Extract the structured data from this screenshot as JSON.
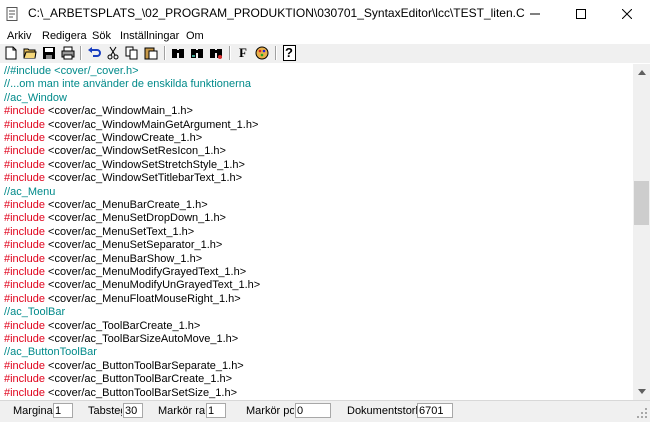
{
  "window": {
    "title": "C:\\_ARBETSPLATS_\\02_PROGRAM_PRODUKTION\\030701_SyntaxEditor\\lcc\\TEST_liten.C"
  },
  "menu": [
    "Arkiv",
    "Redigera",
    "Sök",
    "Inställningar",
    "Om"
  ],
  "toolbar": {
    "icons": [
      "new-file-icon",
      "open-folder-icon",
      "save-icon",
      "print-icon",
      "undo-icon",
      "cut-icon",
      "copy-icon",
      "paste-icon",
      "find-icon",
      "find-next-icon",
      "replace-icon",
      "font-icon",
      "color-icon",
      "help-icon"
    ],
    "font_glyph": "F",
    "help_glyph": "?"
  },
  "editor": {
    "lines": [
      {
        "kw": "",
        "text": "//#include <cover/_cover.h>",
        "kind": "comment"
      },
      {
        "kw": "",
        "text": "//...om man inte använder de enskilda funktionerna",
        "kind": "comment"
      },
      {
        "kw": "",
        "text": "//ac_Window",
        "kind": "comment"
      },
      {
        "kw": "#include",
        "text": " <cover/ac_WindowMain_1.h>",
        "kind": "include"
      },
      {
        "kw": "#include",
        "text": " <cover/ac_WindowMainGetArgument_1.h>",
        "kind": "include"
      },
      {
        "kw": "#include",
        "text": " <cover/ac_WindowCreate_1.h>",
        "kind": "include"
      },
      {
        "kw": "#include",
        "text": " <cover/ac_WindowSetResIcon_1.h>",
        "kind": "include"
      },
      {
        "kw": "#include",
        "text": " <cover/ac_WindowSetStretchStyle_1.h>",
        "kind": "include"
      },
      {
        "kw": "#include",
        "text": " <cover/ac_WindowSetTitlebarText_1.h>",
        "kind": "include"
      },
      {
        "kw": "",
        "text": "//ac_Menu",
        "kind": "comment"
      },
      {
        "kw": "#include",
        "text": " <cover/ac_MenuBarCreate_1.h>",
        "kind": "include"
      },
      {
        "kw": "#include",
        "text": " <cover/ac_MenuSetDropDown_1.h>",
        "kind": "include"
      },
      {
        "kw": "#include",
        "text": " <cover/ac_MenuSetText_1.h>",
        "kind": "include"
      },
      {
        "kw": "#include",
        "text": " <cover/ac_MenuSetSeparator_1.h>",
        "kind": "include"
      },
      {
        "kw": "#include",
        "text": " <cover/ac_MenuBarShow_1.h>",
        "kind": "include"
      },
      {
        "kw": "#include",
        "text": " <cover/ac_MenuModifyGrayedText_1.h>",
        "kind": "include"
      },
      {
        "kw": "#include",
        "text": " <cover/ac_MenuModifyUnGrayedText_1.h>",
        "kind": "include"
      },
      {
        "kw": "#include",
        "text": " <cover/ac_MenuFloatMouseRight_1.h>",
        "kind": "include"
      },
      {
        "kw": "",
        "text": "//ac_ToolBar",
        "kind": "comment"
      },
      {
        "kw": "#include",
        "text": " <cover/ac_ToolBarCreate_1.h>",
        "kind": "include"
      },
      {
        "kw": "#include",
        "text": " <cover/ac_ToolBarSizeAutoMove_1.h>",
        "kind": "include"
      },
      {
        "kw": "",
        "text": "//ac_ButtonToolBar",
        "kind": "comment"
      },
      {
        "kw": "#include",
        "text": " <cover/ac_ButtonToolBarSeparate_1.h>",
        "kind": "include"
      },
      {
        "kw": "#include",
        "text": " <cover/ac_ButtonToolBarCreate_1.h>",
        "kind": "include"
      },
      {
        "kw": "#include",
        "text": " <cover/ac_ButtonToolBarSetSize_1.h>",
        "kind": "include"
      }
    ],
    "colors": {
      "keyword": "#e0001a",
      "comment": "#008a8a",
      "text": "#000000"
    }
  },
  "status": {
    "margin_label": "Margina",
    "margin_value": "1",
    "tab_label": "Tabsteg",
    "tab_value": "30",
    "row_label": "Markör ra",
    "row_value": "1",
    "col_label": "Markör po",
    "col_value": "0",
    "size_label": "Dokumentstorl",
    "size_value": "6701"
  }
}
